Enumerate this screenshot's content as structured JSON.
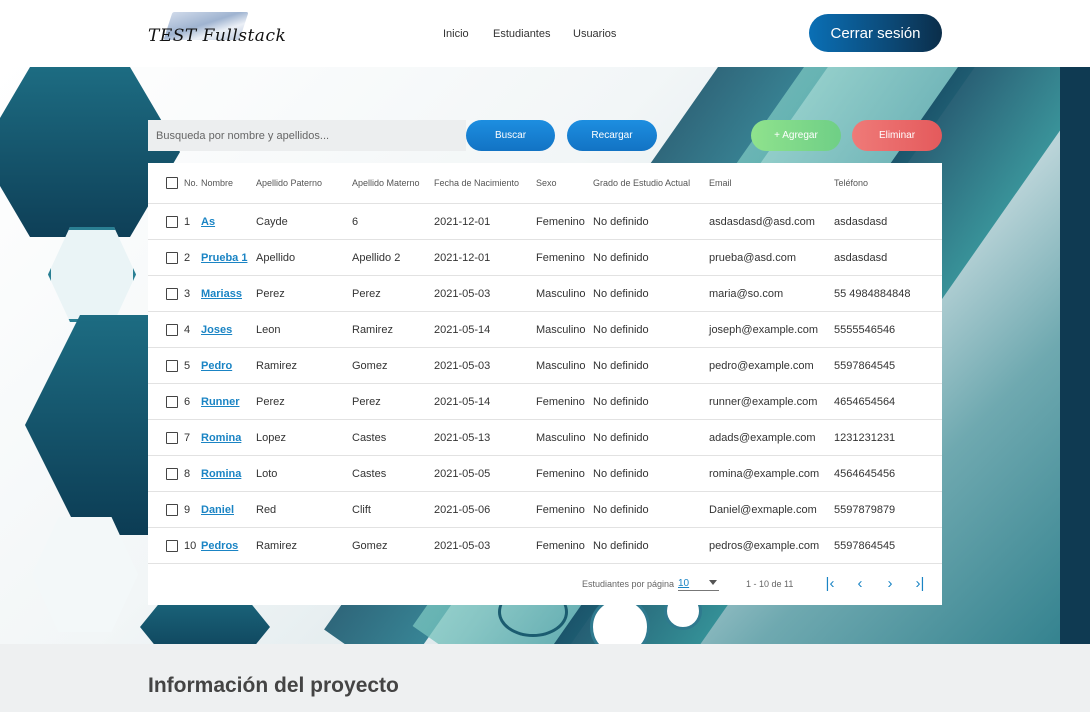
{
  "header": {
    "logo_text": "TEST Fullstack",
    "nav": [
      "Inicio",
      "Estudiantes",
      "Usuarios"
    ],
    "logout_label": "Cerrar sesión"
  },
  "toolbar": {
    "search_placeholder": "Busqueda por nombre y apellidos...",
    "buscar_label": "Buscar",
    "recargar_label": "Recargar",
    "agregar_label": "+ Agregar",
    "eliminar_label": "Eliminar"
  },
  "table": {
    "columns": [
      "No.",
      "Nombre",
      "Apellido Paterno",
      "Apellido Materno",
      "Fecha de Nacimiento",
      "Sexo",
      "Grado de Estudio Actual",
      "Email",
      "Teléfono"
    ],
    "rows": [
      {
        "no": "1",
        "nombre": "As",
        "ap": "Cayde",
        "am": "6",
        "fecha": "2021-12-01",
        "sexo": "Femenino",
        "grado": "No definido",
        "email": "asdasdasd@asd.com",
        "tel": "asdasdasd"
      },
      {
        "no": "2",
        "nombre": "Prueba 1",
        "ap": "Apellido",
        "am": "Apellido 2",
        "fecha": "2021-12-01",
        "sexo": "Femenino",
        "grado": "No definido",
        "email": "prueba@asd.com",
        "tel": "asdasdasd"
      },
      {
        "no": "3",
        "nombre": "Mariass",
        "ap": "Perez",
        "am": "Perez",
        "fecha": "2021-05-03",
        "sexo": "Masculino",
        "grado": "No definido",
        "email": "maria@so.com",
        "tel": "55 4984884848"
      },
      {
        "no": "4",
        "nombre": "Joses",
        "ap": "Leon",
        "am": "Ramirez",
        "fecha": "2021-05-14",
        "sexo": "Masculino",
        "grado": "No definido",
        "email": "joseph@example.com",
        "tel": "5555546546"
      },
      {
        "no": "5",
        "nombre": "Pedro",
        "ap": "Ramirez",
        "am": "Gomez",
        "fecha": "2021-05-03",
        "sexo": "Masculino",
        "grado": "No definido",
        "email": "pedro@example.com",
        "tel": "5597864545"
      },
      {
        "no": "6",
        "nombre": "Runner",
        "ap": "Perez",
        "am": "Perez",
        "fecha": "2021-05-14",
        "sexo": "Femenino",
        "grado": "No definido",
        "email": "runner@example.com",
        "tel": "4654654564"
      },
      {
        "no": "7",
        "nombre": "Romina",
        "ap": "Lopez",
        "am": "Castes",
        "fecha": "2021-05-13",
        "sexo": "Masculino",
        "grado": "No definido",
        "email": "adads@example.com",
        "tel": "1231231231"
      },
      {
        "no": "8",
        "nombre": "Romina",
        "ap": "Loto",
        "am": "Castes",
        "fecha": "2021-05-05",
        "sexo": "Femenino",
        "grado": "No definido",
        "email": "romina@example.com",
        "tel": "4564645456"
      },
      {
        "no": "9",
        "nombre": "Daniel",
        "ap": "Red",
        "am": "Clift",
        "fecha": "2021-05-06",
        "sexo": "Femenino",
        "grado": "No definido",
        "email": "Daniel@exmaple.com",
        "tel": "5597879879"
      },
      {
        "no": "10",
        "nombre": "Pedros",
        "ap": "Ramirez",
        "am": "Gomez",
        "fecha": "2021-05-03",
        "sexo": "Femenino",
        "grado": "No definido",
        "email": "pedros@example.com",
        "tel": "5597864545"
      }
    ]
  },
  "pagination": {
    "label": "Estudiantes por página",
    "page_size": "10",
    "range": "1 - 10 de 11",
    "first_icon": "first-page-icon",
    "prev_icon": "chevron-left-icon",
    "next_icon": "chevron-right-icon",
    "last_icon": "last-page-icon"
  },
  "footer": {
    "title": "Información del proyecto"
  },
  "colors": {
    "primary": "#1273c4",
    "add": "#6fcf86",
    "delete": "#e45a5c",
    "link": "#1a84c4"
  }
}
